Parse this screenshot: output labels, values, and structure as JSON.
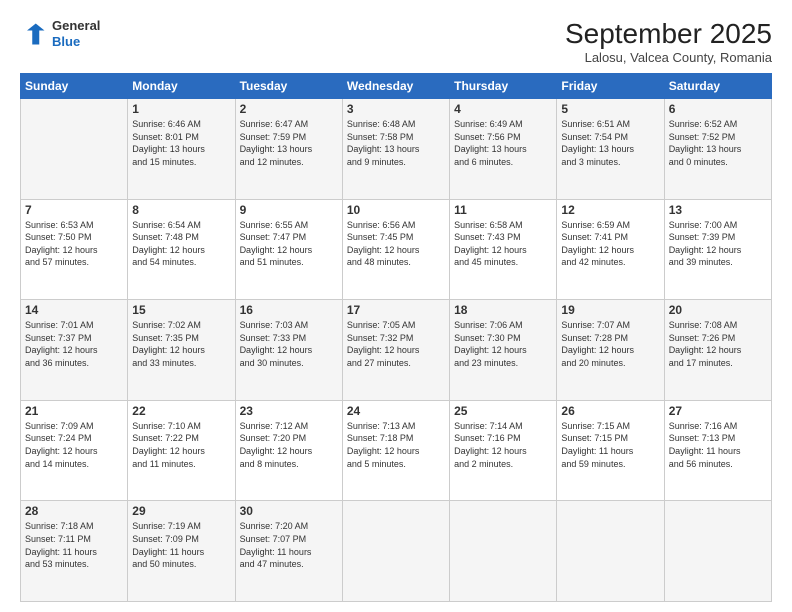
{
  "logo": {
    "general": "General",
    "blue": "Blue"
  },
  "title": "September 2025",
  "subtitle": "Lalosu, Valcea County, Romania",
  "headers": [
    "Sunday",
    "Monday",
    "Tuesday",
    "Wednesday",
    "Thursday",
    "Friday",
    "Saturday"
  ],
  "rows": [
    [
      {
        "num": "",
        "info": ""
      },
      {
        "num": "1",
        "info": "Sunrise: 6:46 AM\nSunset: 8:01 PM\nDaylight: 13 hours\nand 15 minutes."
      },
      {
        "num": "2",
        "info": "Sunrise: 6:47 AM\nSunset: 7:59 PM\nDaylight: 13 hours\nand 12 minutes."
      },
      {
        "num": "3",
        "info": "Sunrise: 6:48 AM\nSunset: 7:58 PM\nDaylight: 13 hours\nand 9 minutes."
      },
      {
        "num": "4",
        "info": "Sunrise: 6:49 AM\nSunset: 7:56 PM\nDaylight: 13 hours\nand 6 minutes."
      },
      {
        "num": "5",
        "info": "Sunrise: 6:51 AM\nSunset: 7:54 PM\nDaylight: 13 hours\nand 3 minutes."
      },
      {
        "num": "6",
        "info": "Sunrise: 6:52 AM\nSunset: 7:52 PM\nDaylight: 13 hours\nand 0 minutes."
      }
    ],
    [
      {
        "num": "7",
        "info": "Sunrise: 6:53 AM\nSunset: 7:50 PM\nDaylight: 12 hours\nand 57 minutes."
      },
      {
        "num": "8",
        "info": "Sunrise: 6:54 AM\nSunset: 7:48 PM\nDaylight: 12 hours\nand 54 minutes."
      },
      {
        "num": "9",
        "info": "Sunrise: 6:55 AM\nSunset: 7:47 PM\nDaylight: 12 hours\nand 51 minutes."
      },
      {
        "num": "10",
        "info": "Sunrise: 6:56 AM\nSunset: 7:45 PM\nDaylight: 12 hours\nand 48 minutes."
      },
      {
        "num": "11",
        "info": "Sunrise: 6:58 AM\nSunset: 7:43 PM\nDaylight: 12 hours\nand 45 minutes."
      },
      {
        "num": "12",
        "info": "Sunrise: 6:59 AM\nSunset: 7:41 PM\nDaylight: 12 hours\nand 42 minutes."
      },
      {
        "num": "13",
        "info": "Sunrise: 7:00 AM\nSunset: 7:39 PM\nDaylight: 12 hours\nand 39 minutes."
      }
    ],
    [
      {
        "num": "14",
        "info": "Sunrise: 7:01 AM\nSunset: 7:37 PM\nDaylight: 12 hours\nand 36 minutes."
      },
      {
        "num": "15",
        "info": "Sunrise: 7:02 AM\nSunset: 7:35 PM\nDaylight: 12 hours\nand 33 minutes."
      },
      {
        "num": "16",
        "info": "Sunrise: 7:03 AM\nSunset: 7:33 PM\nDaylight: 12 hours\nand 30 minutes."
      },
      {
        "num": "17",
        "info": "Sunrise: 7:05 AM\nSunset: 7:32 PM\nDaylight: 12 hours\nand 27 minutes."
      },
      {
        "num": "18",
        "info": "Sunrise: 7:06 AM\nSunset: 7:30 PM\nDaylight: 12 hours\nand 23 minutes."
      },
      {
        "num": "19",
        "info": "Sunrise: 7:07 AM\nSunset: 7:28 PM\nDaylight: 12 hours\nand 20 minutes."
      },
      {
        "num": "20",
        "info": "Sunrise: 7:08 AM\nSunset: 7:26 PM\nDaylight: 12 hours\nand 17 minutes."
      }
    ],
    [
      {
        "num": "21",
        "info": "Sunrise: 7:09 AM\nSunset: 7:24 PM\nDaylight: 12 hours\nand 14 minutes."
      },
      {
        "num": "22",
        "info": "Sunrise: 7:10 AM\nSunset: 7:22 PM\nDaylight: 12 hours\nand 11 minutes."
      },
      {
        "num": "23",
        "info": "Sunrise: 7:12 AM\nSunset: 7:20 PM\nDaylight: 12 hours\nand 8 minutes."
      },
      {
        "num": "24",
        "info": "Sunrise: 7:13 AM\nSunset: 7:18 PM\nDaylight: 12 hours\nand 5 minutes."
      },
      {
        "num": "25",
        "info": "Sunrise: 7:14 AM\nSunset: 7:16 PM\nDaylight: 12 hours\nand 2 minutes."
      },
      {
        "num": "26",
        "info": "Sunrise: 7:15 AM\nSunset: 7:15 PM\nDaylight: 11 hours\nand 59 minutes."
      },
      {
        "num": "27",
        "info": "Sunrise: 7:16 AM\nSunset: 7:13 PM\nDaylight: 11 hours\nand 56 minutes."
      }
    ],
    [
      {
        "num": "28",
        "info": "Sunrise: 7:18 AM\nSunset: 7:11 PM\nDaylight: 11 hours\nand 53 minutes."
      },
      {
        "num": "29",
        "info": "Sunrise: 7:19 AM\nSunset: 7:09 PM\nDaylight: 11 hours\nand 50 minutes."
      },
      {
        "num": "30",
        "info": "Sunrise: 7:20 AM\nSunset: 7:07 PM\nDaylight: 11 hours\nand 47 minutes."
      },
      {
        "num": "",
        "info": ""
      },
      {
        "num": "",
        "info": ""
      },
      {
        "num": "",
        "info": ""
      },
      {
        "num": "",
        "info": ""
      }
    ]
  ]
}
